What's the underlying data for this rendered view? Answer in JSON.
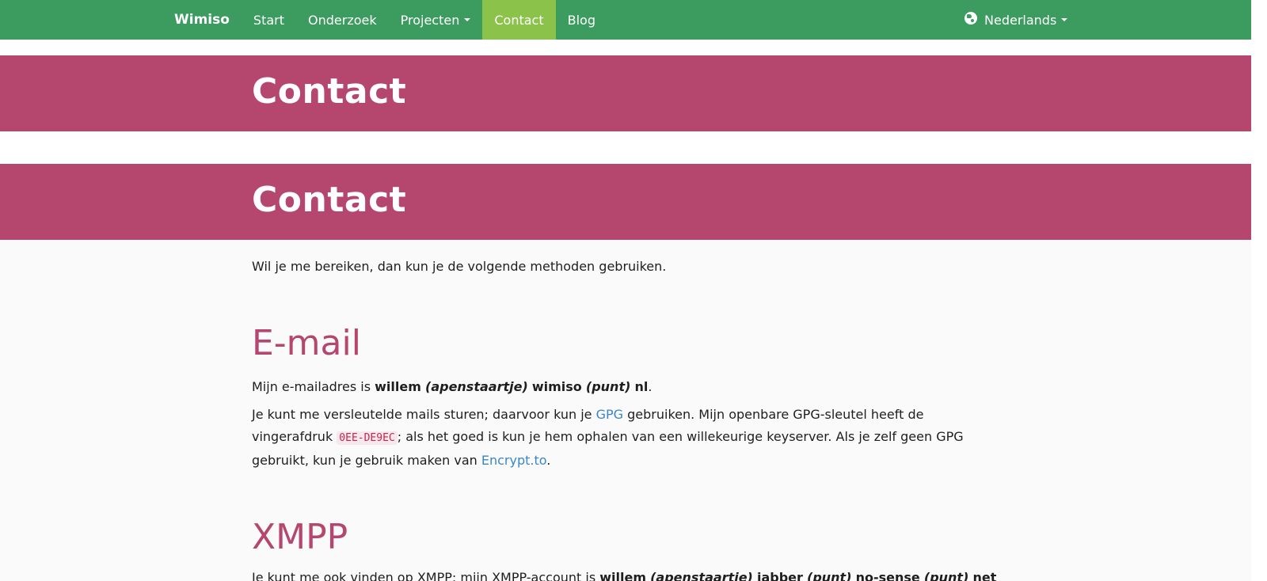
{
  "navbar": {
    "brand": "Wimiso",
    "items": [
      {
        "label": "Start"
      },
      {
        "label": "Onderzoek"
      },
      {
        "label": "Projecten"
      },
      {
        "label": "Contact"
      },
      {
        "label": "Blog"
      }
    ],
    "language": "Nederlands",
    "colors": {
      "background": "#3c9c5f",
      "active": "#8bc34a"
    }
  },
  "banners": {
    "first_title": "Contact",
    "second_title": "Contact",
    "color": "#b5476f"
  },
  "content": {
    "intro": "Wil je me bereiken, dan kun je de volgende methoden gebruiken.",
    "email": {
      "heading": "E-mail",
      "line_prefix": "Mijn e-mailadres is ",
      "user": "willem",
      "at": "(apenstaartje)",
      "domain": "wimiso",
      "dot": "(punt)",
      "tld": "nl",
      "line_suffix": "."
    },
    "gpg": {
      "text1": "Je kunt me versleutelde mails sturen; daarvoor kun je ",
      "gpg_link": "GPG",
      "text2": " gebruiken. Mijn openbare GPG-sleutel heeft de vingerafdruk ",
      "fingerprint": "0EE-DE9EC",
      "text3": "; als het goed is kun je hem ophalen van een willekeurige keyserver. Als je zelf geen GPG gebruikt, kun je gebruik maken van ",
      "encrypt_link": "Encrypt.to",
      "text4": "."
    },
    "xmpp": {
      "heading": "XMPP",
      "line_prefix": "Je kunt me ook vinden op XMPP; mijn XMPP-account is ",
      "user": "willem",
      "at": "(apenstaartje)",
      "host": "jabber",
      "dot1": "(punt)",
      "domain": "no-sense",
      "dot2": "(punt)",
      "tld": "net"
    }
  }
}
